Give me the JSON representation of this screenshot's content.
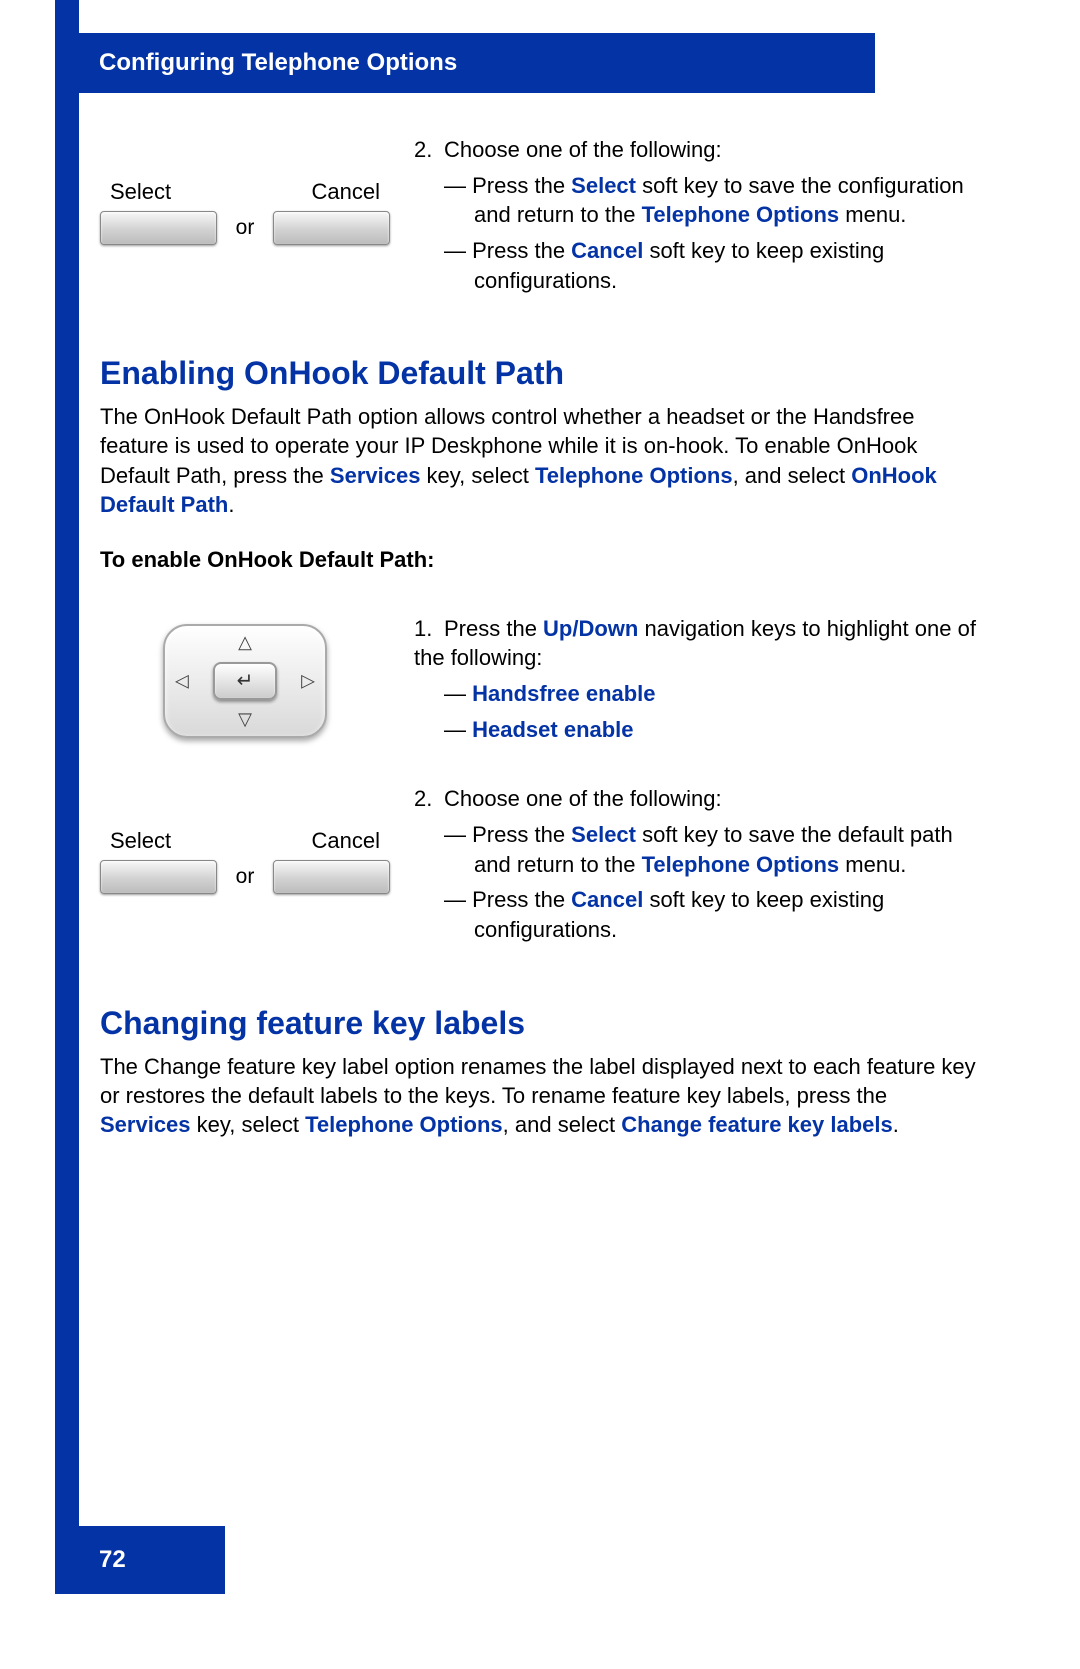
{
  "header": {
    "title": "Configuring Telephone Options"
  },
  "step2_top": {
    "num": "2.",
    "lead": "Choose one of the following:",
    "items": [
      {
        "pre": "Press the ",
        "bold": "Select",
        "mid": " soft key to save the configuration and return to the ",
        "bold2": "Telephone Options",
        "post": " menu."
      },
      {
        "pre": "Press the ",
        "bold": "Cancel",
        "mid": " soft key to keep existing configurations.",
        "bold2": "",
        "post": ""
      }
    ],
    "softkeys": {
      "select": "Select",
      "cancel": "Cancel",
      "or": "or"
    }
  },
  "section1": {
    "title": "Enabling OnHook Default Path",
    "para_pre": "The OnHook Default Path option allows control whether a headset or the Handsfree feature is used to operate your IP Deskphone while it is on-hook. To enable OnHook Default Path, press the ",
    "services": "Services",
    "mid1": " key, select ",
    "telopt": "Telephone Options",
    "mid2": ", and select ",
    "onhook": "OnHook Default Path",
    "post": ".",
    "sub": "To enable OnHook Default Path:"
  },
  "step1_mid": {
    "num": "1.",
    "pre": "Press the ",
    "updown": "Up/Down",
    "post": " navigation keys to highlight one of the following:",
    "opt1": "Handsfree enable",
    "opt2": "Headset enable"
  },
  "step2_mid": {
    "num": "2.",
    "lead": "Choose one of the following:",
    "items": [
      {
        "pre": "Press the ",
        "bold": "Select",
        "mid": " soft key to save the default path and return to the ",
        "bold2": "Telephone Options",
        "post": " menu."
      },
      {
        "pre": "Press the ",
        "bold": "Cancel",
        "mid": " soft key to keep existing configurations.",
        "bold2": "",
        "post": ""
      }
    ],
    "softkeys": {
      "select": "Select",
      "cancel": "Cancel",
      "or": "or"
    }
  },
  "section2": {
    "title": "Changing feature key labels",
    "para_pre": "The Change feature key label option renames the label displayed next to each feature key or restores the default labels to the keys. To rename feature key labels, press the ",
    "services": "Services",
    "mid1": " key, select ",
    "telopt": "Telephone Options",
    "mid2": ", and select ",
    "chg": "Change feature key labels",
    "post": "."
  },
  "footer": {
    "page": "72"
  },
  "dash": "—"
}
